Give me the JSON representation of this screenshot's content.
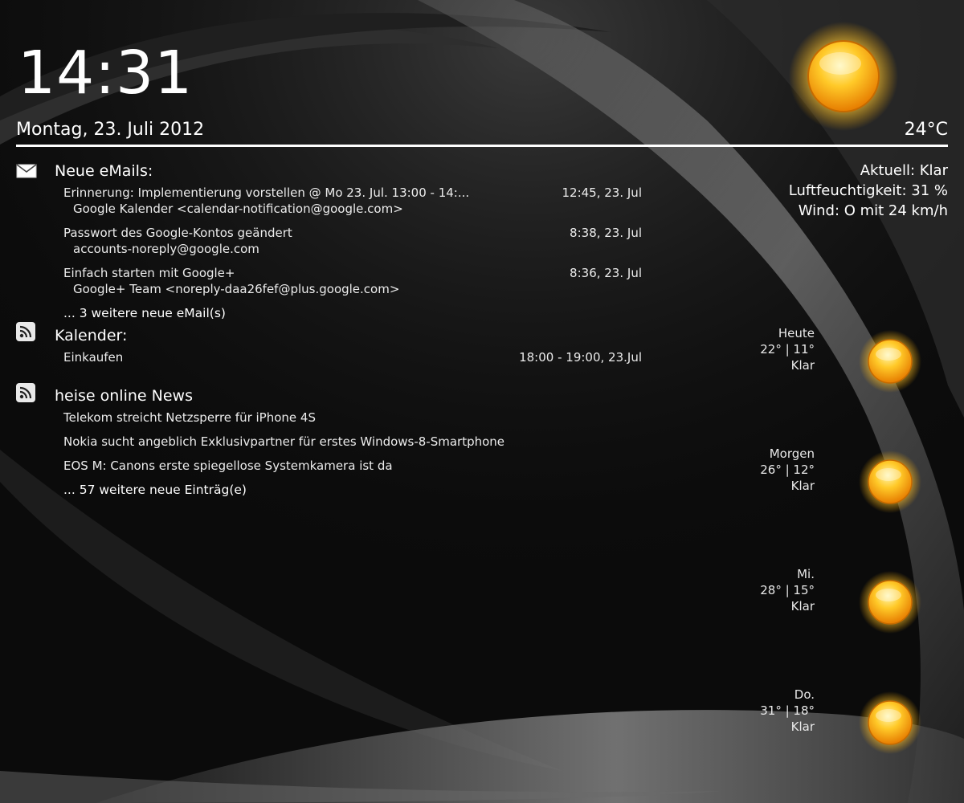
{
  "clock": "14:31",
  "date": "Montag, 23. Juli 2012",
  "weather": {
    "temperature": "24°C",
    "icon": "sun-icon",
    "current": "Aktuell: Klar",
    "humidity": "Luftfeuchtigkeit: 31 %",
    "wind": "Wind: O mit 24 km/h"
  },
  "emails": {
    "title": "Neue eMails:",
    "icon": "mail-icon",
    "items": [
      {
        "subject": "Erinnerung: Implementierung vorstellen @ Mo 23. Jul. 13:00 - 14:...",
        "sender": "Google Kalender <calendar-notification@google.com>",
        "time": "12:45, 23. Jul"
      },
      {
        "subject": "Passwort des Google-Kontos geändert",
        "sender": "accounts-noreply@google.com",
        "time": "8:38, 23. Jul"
      },
      {
        "subject": "Einfach starten mit Google+",
        "sender": "Google+ Team <noreply-daa26fef@plus.google.com>",
        "time": "8:36, 23. Jul"
      }
    ],
    "more": "... 3 weitere neue eMail(s)"
  },
  "calendar": {
    "title": "Kalender:",
    "icon": "rss-icon",
    "items": [
      {
        "title": "Einkaufen",
        "time": "18:00 - 19:00, 23.Jul"
      }
    ]
  },
  "news": {
    "title": "heise online News",
    "icon": "rss-icon",
    "items": [
      "Telekom streicht Netzsperre für iPhone 4S",
      "Nokia sucht angeblich Exklusivpartner für erstes Windows-8-Smartphone",
      "EOS M: Canons erste spiegellose Systemkamera ist da"
    ],
    "more": "... 57 weitere neue Einträg(e)"
  },
  "forecast": [
    {
      "day": "Heute",
      "temps": "22° | 11°",
      "cond": "Klar",
      "icon": "sun-icon"
    },
    {
      "day": "Morgen",
      "temps": "26° | 12°",
      "cond": "Klar",
      "icon": "sun-icon"
    },
    {
      "day": "Mi.",
      "temps": "28° | 15°",
      "cond": "Klar",
      "icon": "sun-icon"
    },
    {
      "day": "Do.",
      "temps": "31° | 18°",
      "cond": "Klar",
      "icon": "sun-icon"
    }
  ],
  "colors": {
    "background": "#0b0b0b",
    "text": "#ffffff",
    "sun_core": "#f7a51a",
    "sun_highlight": "#fff2a0"
  }
}
